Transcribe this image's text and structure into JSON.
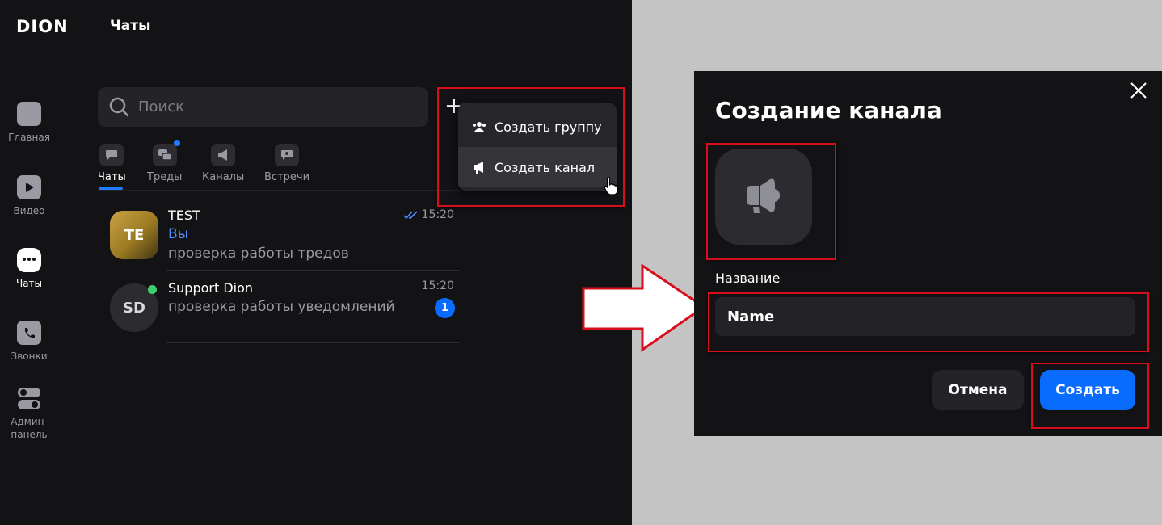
{
  "header": {
    "logo": "DION",
    "title": "Чаты"
  },
  "sidebar": {
    "items": [
      {
        "label": "Главная",
        "icon": "home-icon"
      },
      {
        "label": "Видео",
        "icon": "video-play-icon"
      },
      {
        "label": "Чаты",
        "icon": "chat-bubble-icon",
        "active": true
      },
      {
        "label": "Звонки",
        "icon": "phone-calendar-icon"
      },
      {
        "label": "Админ-\nпанель",
        "icon": "toggles-icon"
      }
    ]
  },
  "search": {
    "placeholder": "Поиск"
  },
  "plus_label": "+",
  "filter_tabs": [
    {
      "label": "Чаты",
      "active": true
    },
    {
      "label": "Треды",
      "has_dot": true
    },
    {
      "label": "Каналы"
    },
    {
      "label": "Встречи"
    }
  ],
  "chats": [
    {
      "avatar": "TE",
      "name": "TEST",
      "sender": "Вы",
      "preview": "проверка работы тредов",
      "time": "15:20",
      "read": true
    },
    {
      "avatar": "SD",
      "name": "Support Dion",
      "preview": "проверка работы уведомлений",
      "time": "15:20",
      "unread": "1",
      "online": true
    }
  ],
  "dropdown": {
    "items": [
      {
        "label": "Создать группу",
        "icon": "group-icon"
      },
      {
        "label": "Создать канал",
        "icon": "megaphone-icon",
        "hover": true
      }
    ]
  },
  "modal": {
    "title": "Создание канала",
    "field_label": "Название",
    "input_placeholder": "Name",
    "cancel_label": "Отмена",
    "create_label": "Создать"
  },
  "colors": {
    "accent": "#0a6cff",
    "annotation_red": "#d90d1c",
    "background_dark": "#131316"
  }
}
